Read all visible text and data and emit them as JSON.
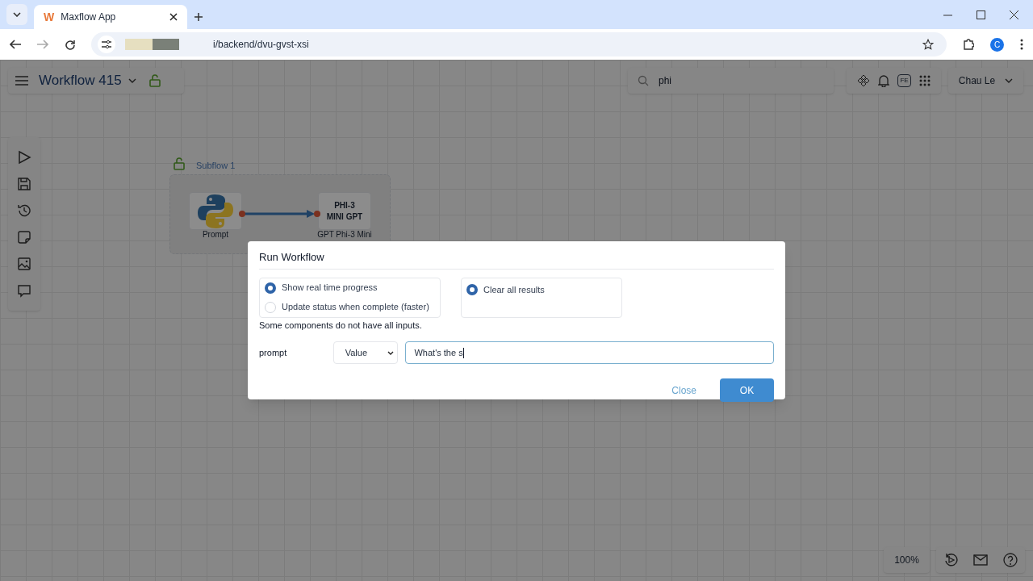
{
  "browser": {
    "tab": {
      "logo": "W",
      "title": "Maxflow App"
    },
    "address": "i/backend/dvu-gvst-xsi",
    "profile": "C"
  },
  "header": {
    "title": "Workflow 415",
    "search": {
      "value": "phi"
    },
    "toolbar_badge": "FE",
    "user": "Chau Le"
  },
  "canvas": {
    "group": {
      "title": "Subflow 1"
    },
    "nodes": [
      {
        "kind": "python",
        "label": "Prompt"
      },
      {
        "kind": "text",
        "title": "PHI-3\nMINI GPT",
        "label": "GPT Phi-3 Mini"
      }
    ]
  },
  "zoom": "100%",
  "dialog": {
    "title": "Run Workflow",
    "progress_options": [
      {
        "label": "Show real time progress",
        "selected": true
      },
      {
        "label": "Update status when complete (faster)",
        "selected": false
      }
    ],
    "clear_options": [
      {
        "label": "Clear all results",
        "selected": true
      }
    ],
    "warning": "Some components do not have all inputs.",
    "inputs": [
      {
        "name": "prompt",
        "mode": "Value",
        "value": "What's the s"
      }
    ],
    "buttons": [
      {
        "kind": "secondary",
        "label": "Close"
      },
      {
        "kind": "primary",
        "label": "OK"
      }
    ]
  }
}
